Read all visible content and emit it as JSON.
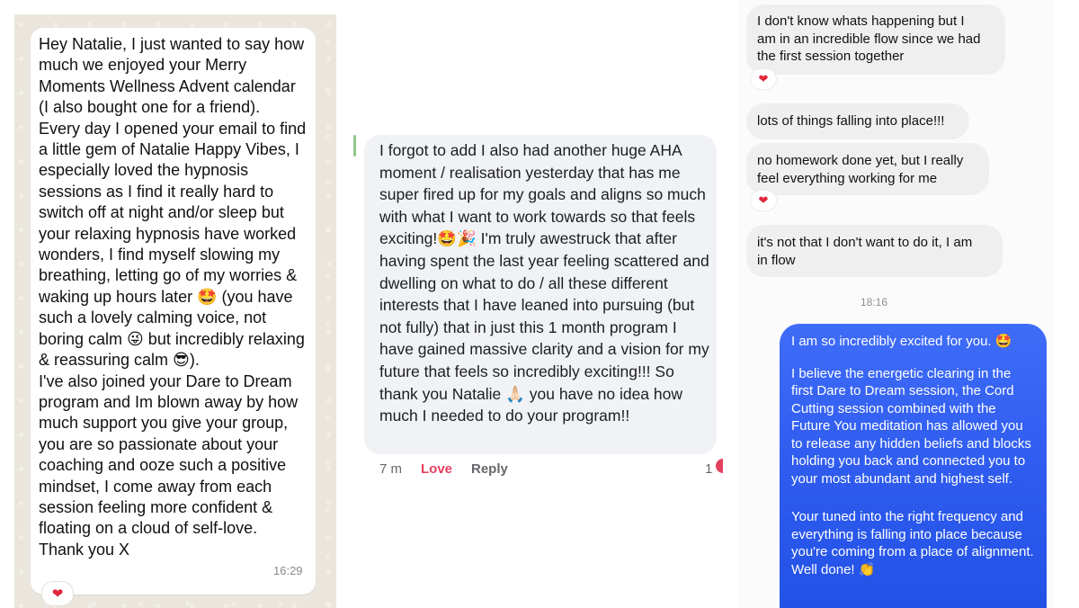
{
  "whatsapp": {
    "message": "Hey Natalie, I just wanted to say how much we enjoyed your Merry Moments Wellness Advent calendar (I also bought one for a friend).\nEvery day I opened your email to find a little gem of Natalie Happy Vibes, I especially loved the hypnosis sessions as I find it really hard to switch off at night and/or sleep but your relaxing hypnosis have worked wonders, I find myself slowing my breathing, letting go of my worries & waking up hours later 🤩 (you have such a lovely calming voice, not boring calm 😜 but incredibly relaxing & reassuring calm 😎).\nI've also joined your Dare to Dream program and Im blown away by how much support you give your group, you are so passionate about your coaching and ooze such a positive mindset, I come away from each session feeling more confident & floating on a cloud of self-love.\nThank you X",
    "time": "16:29",
    "reaction": "❤"
  },
  "facebook": {
    "message": "I forgot to add I also had another huge AHA moment / realisation yesterday that has me super fired up for my goals and aligns so much with what I want to work towards so that feels exciting!🤩🎉 I'm truly awestruck that after having spent the last year feeling scattered and dwelling on what to do / all these different interests that I have leaned into pursuing (but not fully) that in just this 1 month program I have gained massive clarity and a vision for my future that feels so incredibly exciting!!! So thank you Natalie 🙏🏻 you have no idea how much I needed to do your program!!",
    "time": "7 m",
    "love_label": "Love",
    "reply_label": "Reply",
    "reaction_count": "1"
  },
  "instagram": {
    "incoming": [
      {
        "text": "I don't know whats happening but I\nam in an incredible flow since we had\nthe first session together"
      },
      {
        "text": "lots of things falling into place!!!"
      },
      {
        "text": "no homework done yet, but I really\nfeel everything working for me"
      },
      {
        "text": "it's not that I don't want to do it, I am\nin flow"
      }
    ],
    "heart": "❤",
    "timestamp": "18:16",
    "outgoing": {
      "p1": "I am so incredibly excited for you. 🤩",
      "p2": "I believe the energetic clearing in the first Dare to Dream session, the Cord Cutting session combined with the Future You meditation has allowed you to release any hidden beliefs and blocks holding you back and connected you to your most abundant and highest self.",
      "p3": "Your tuned into the right frequency and everything is falling into place because you're coming from a place of alignment. Well done! 👏"
    }
  }
}
